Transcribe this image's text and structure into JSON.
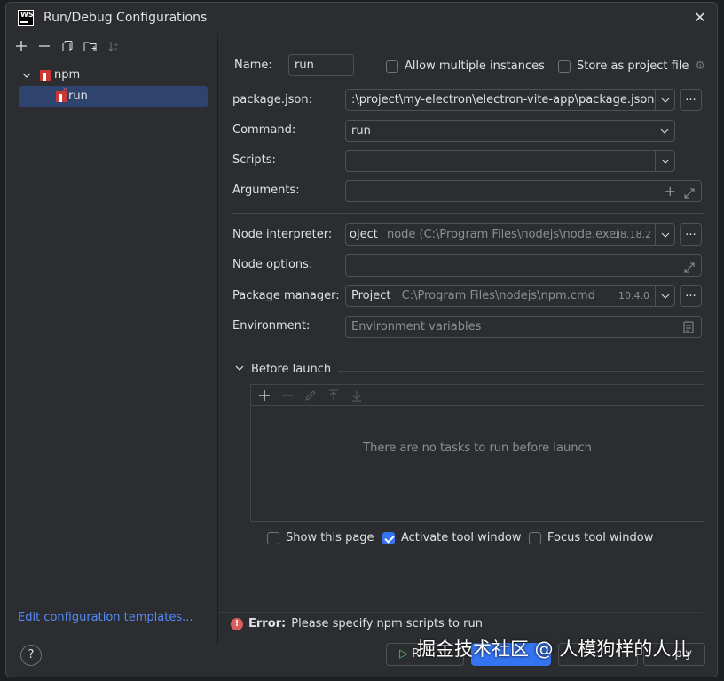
{
  "window": {
    "title": "Run/Debug Configurations",
    "app_icon_text": "WS"
  },
  "toolbar": [
    "add-icon",
    "remove-icon",
    "copy-icon",
    "folder-icon",
    "sort-icon"
  ],
  "tree": {
    "group_label": "npm",
    "item_label": "run"
  },
  "edit_templates": "Edit configuration templates...",
  "form": {
    "name_label": "Name:",
    "name_value": "run",
    "allow_multiple": "Allow multiple instances",
    "store_project": "Store as project file",
    "package_json_label": "package.json:",
    "package_json_value": ":\\project\\my-electron\\electron-vite-app\\package.json",
    "command_label": "Command:",
    "command_value": "run",
    "scripts_label": "Scripts:",
    "arguments_label": "Arguments:",
    "node_interpreter_label": "Node interpreter:",
    "node_interpreter_prefix": "oject",
    "node_interpreter_path": "node (C:\\Program Files\\nodejs\\node.exe)",
    "node_interpreter_version": "18.18.2",
    "node_options_label": "Node options:",
    "package_manager_label": "Package manager:",
    "package_manager_prefix": "Project",
    "package_manager_path": "C:\\Program Files\\nodejs\\npm.cmd",
    "package_manager_version": "10.4.0",
    "environment_label": "Environment:",
    "environment_placeholder": "Environment variables",
    "dots": "..."
  },
  "before_launch": {
    "title": "Before launch",
    "empty_text": "There are no tasks to run before launch",
    "show_page": "Show this page",
    "activate_tool": "Activate tool window",
    "focus_tool": "Focus tool window"
  },
  "error": {
    "prefix": "Error:",
    "message": "Please specify npm scripts to run"
  },
  "buttons": {
    "help": "?",
    "run": "R",
    "apply": "ply"
  },
  "watermark": "掘金技术社区 @ 人模狗样的人儿",
  "colors": {
    "accent": "#3574f0",
    "error": "#db5c5c",
    "link": "#548af7",
    "npm": "#cb3837"
  }
}
